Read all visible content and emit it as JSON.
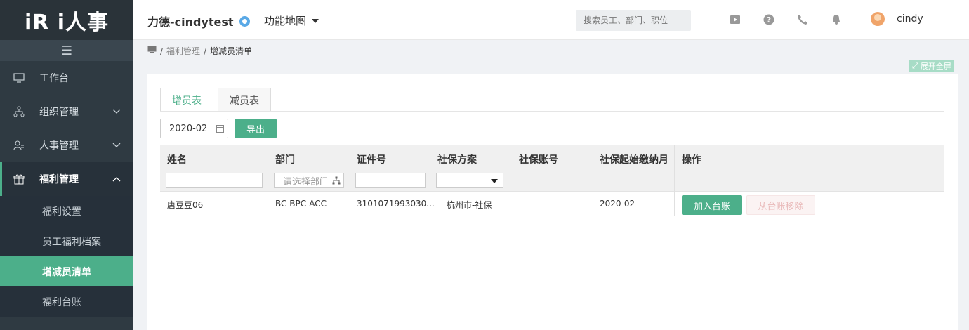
{
  "sidebar": {
    "logo": "iR i人事",
    "menu": [
      {
        "label": "工作台",
        "icon": "monitor-icon"
      },
      {
        "label": "组织管理",
        "icon": "org-chart-icon"
      },
      {
        "label": "人事管理",
        "icon": "person-icon"
      },
      {
        "label": "福利管理",
        "icon": "gift-icon"
      }
    ],
    "submenu": [
      {
        "label": "福利设置"
      },
      {
        "label": "员工福利档案"
      },
      {
        "label": "增减员清单"
      },
      {
        "label": "福利台账"
      }
    ]
  },
  "header": {
    "company": "力德-cindytest",
    "funcmap": "功能地图",
    "search_placeholder": "搜索员工、部门、职位",
    "username": "cindy"
  },
  "breadcrumb": {
    "parent": "福利管理",
    "current": "增减员清单",
    "fullscreen": "展开全屏"
  },
  "tabs": [
    {
      "label": "增员表"
    },
    {
      "label": "减员表"
    }
  ],
  "toolbar": {
    "month": "2020-02",
    "export": "导出"
  },
  "table": {
    "columns": [
      "姓名",
      "部门",
      "证件号",
      "社保方案",
      "社保账号",
      "社保起始缴纳月",
      "操作"
    ],
    "dept_placeholder": "请选择部门",
    "rows": [
      {
        "name": "唐豆豆06",
        "dept": "BC-BPC-ACC",
        "id": "3101071993030...",
        "plan": "杭州市-社保",
        "account": "",
        "start": "2020-02",
        "add": "加入台账",
        "remove": "从台账移除"
      }
    ]
  },
  "colors": {
    "accent": "#4caf8a",
    "sidebar": "#2f3a42"
  }
}
